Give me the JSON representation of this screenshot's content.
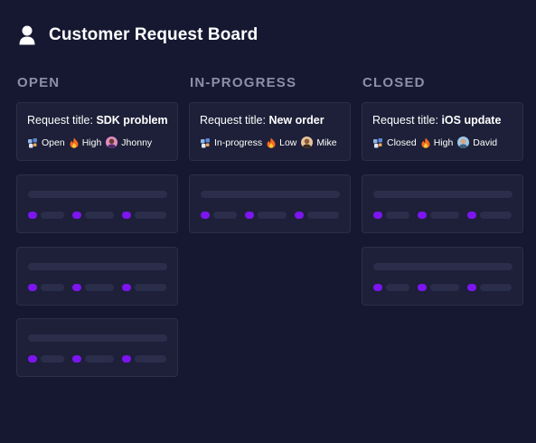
{
  "header": {
    "title": "Customer Request Board",
    "icon": "user-icon"
  },
  "columns": [
    {
      "title": "OPEN",
      "card": {
        "prefix": "Request title:",
        "title": "SDK problem",
        "status": "Open",
        "priority": "High",
        "assignee": "Jhonny"
      }
    },
    {
      "title": "IN-PROGRESS",
      "card": {
        "prefix": "Request title:",
        "title": "New order",
        "status": "In-progress",
        "priority": "Low",
        "assignee": "Mike"
      }
    },
    {
      "title": "CLOSED",
      "card": {
        "prefix": "Request title:",
        "title": "iOS update",
        "status": "Closed",
        "priority": "High",
        "assignee": "David"
      }
    }
  ],
  "colors": {
    "background": "#161832",
    "card": "#1d2038",
    "accent": "#7c15f0",
    "muted": "#8c8fa8"
  }
}
